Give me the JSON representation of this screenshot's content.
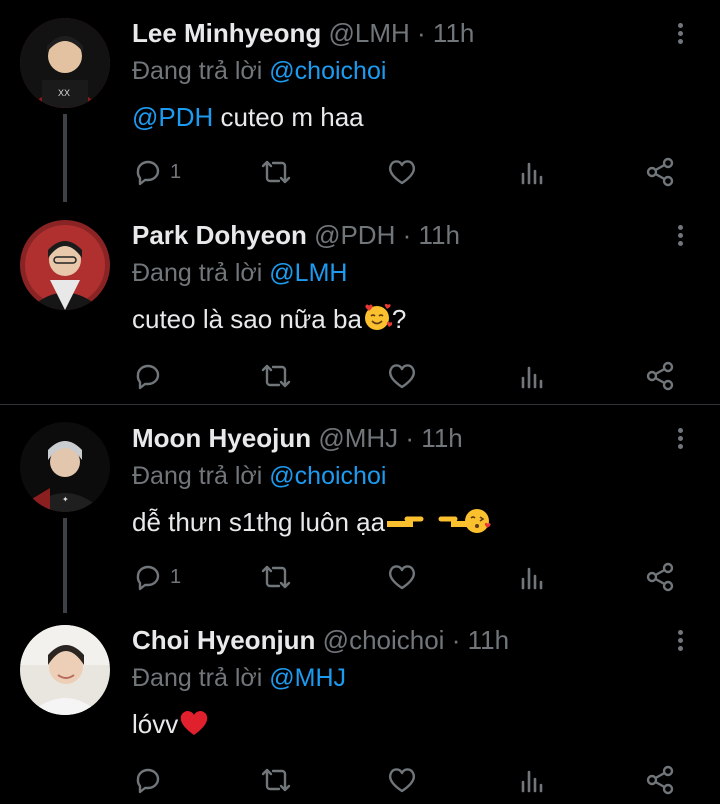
{
  "tweets": [
    {
      "name": "Lee Minhyeong",
      "handle": "@LMH",
      "dot": "·",
      "time": "11h",
      "reply_prefix": "Đang trả lời",
      "reply_to": "@choichoi",
      "mention": "@PDH",
      "text": " cuteo m haa",
      "reply_count": "1",
      "avatar_colors": [
        "#7a1a1a",
        "#1a1a1a"
      ]
    },
    {
      "name": "Park Dohyeon",
      "handle": "@PDH",
      "dot": "·",
      "time": "11h",
      "reply_prefix": "Đang trả lời",
      "reply_to": "@LMH",
      "mention": "",
      "text": "cuteo là sao nữa ba",
      "text_after_emoji": "?",
      "emoji": "smiling-face-with-hearts",
      "reply_count": "",
      "avatar_colors": [
        "#9a2a2a",
        "#222222"
      ]
    },
    {
      "name": "Moon Hyeojun",
      "handle": "@MHJ",
      "dot": "·",
      "time": "11h",
      "reply_prefix": "Đang trả lời",
      "reply_to": "@choichoi",
      "mention": "",
      "text": "dễ thưn s1thg luôn ạa",
      "emoji": "pointing-hands-kiss",
      "reply_count": "1",
      "avatar_colors": [
        "#6e7a80",
        "#111111"
      ]
    },
    {
      "name": "Choi Hyeonjun",
      "handle": "@choichoi",
      "dot": "·",
      "time": "11h",
      "reply_prefix": "Đang trả lời",
      "reply_to": "@MHJ",
      "mention": "",
      "text": "lóvv",
      "emoji": "red-heart",
      "reply_count": "",
      "avatar_colors": [
        "#d9d4cc",
        "#8a8780"
      ]
    }
  ],
  "colors": {
    "background": "#000000",
    "text": "#e7e9ea",
    "muted": "#71767b",
    "accent": "#1d9bf0"
  }
}
